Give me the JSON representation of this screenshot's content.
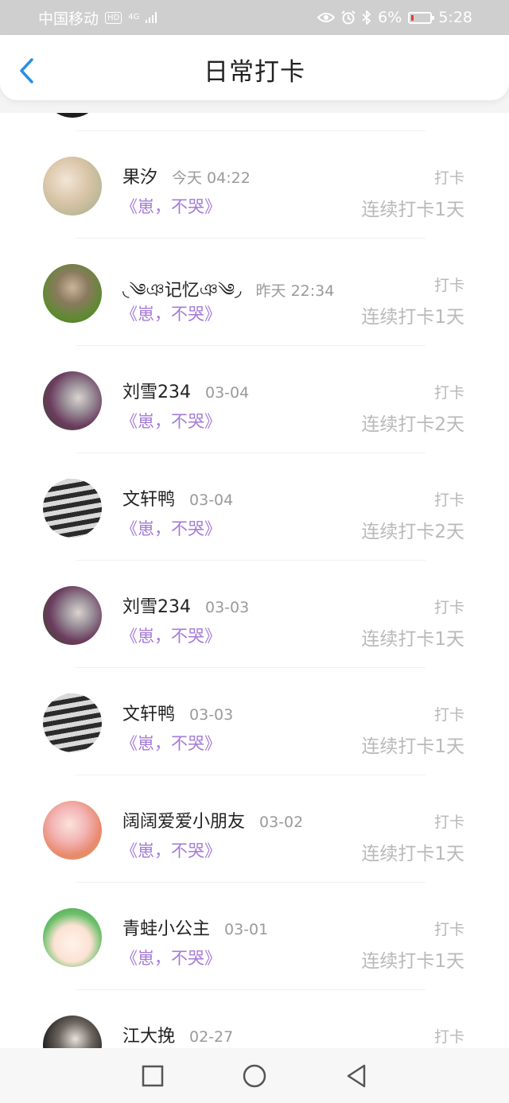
{
  "status_bar": {
    "carrier": "中国移动",
    "network_badge": "HD",
    "signal": "4G",
    "battery_percent": "6%",
    "time": "5:28",
    "icons": [
      "eye-icon",
      "alarm-icon",
      "bluetooth-icon",
      "battery-icon"
    ]
  },
  "header": {
    "title": "日常打卡",
    "back_icon": "chevron-left-icon"
  },
  "colors": {
    "accent": "#2a8fe6",
    "book": "#a57bd8",
    "muted": "#b9b9b9"
  },
  "checkins": [
    {
      "name": "果汐",
      "time": "今天 04:22",
      "book": "《崽，不哭》",
      "action": "打卡",
      "streak": "连续打卡1天"
    },
    {
      "name": "◟༄ঞ记忆ঞ༄◞",
      "time": "昨天 22:34",
      "book": "《崽，不哭》",
      "action": "打卡",
      "streak": "连续打卡1天"
    },
    {
      "name": "刘雪234",
      "time": "03-04",
      "book": "《崽，不哭》",
      "action": "打卡",
      "streak": "连续打卡2天"
    },
    {
      "name": "文轩鸭",
      "time": "03-04",
      "book": "《崽，不哭》",
      "action": "打卡",
      "streak": "连续打卡2天"
    },
    {
      "name": "刘雪234",
      "time": "03-03",
      "book": "《崽，不哭》",
      "action": "打卡",
      "streak": "连续打卡1天"
    },
    {
      "name": "文轩鸭",
      "time": "03-03",
      "book": "《崽，不哭》",
      "action": "打卡",
      "streak": "连续打卡1天"
    },
    {
      "name": "阔阔爱爱小朋友",
      "time": "03-02",
      "book": "《崽，不哭》",
      "action": "打卡",
      "streak": "连续打卡1天"
    },
    {
      "name": "青蛙小公主",
      "time": "03-01",
      "book": "《崽，不哭》",
      "action": "打卡",
      "streak": "连续打卡1天"
    },
    {
      "name": "江大挽",
      "time": "02-27",
      "book": "",
      "action": "打卡",
      "streak": ""
    }
  ],
  "nav_bar": {
    "icons": [
      "square-icon",
      "circle-icon",
      "triangle-back-icon"
    ]
  }
}
